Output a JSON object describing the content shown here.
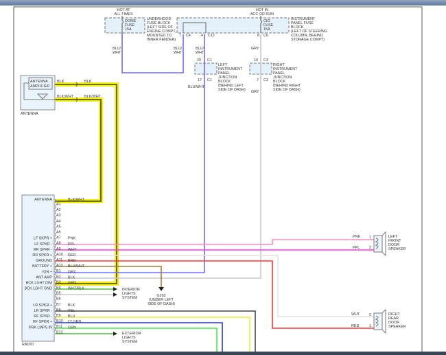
{
  "colors": {
    "blu_wht": "#6b6bff",
    "gry": "#c8c8c8",
    "blk": "#444444",
    "pnk": "#ff88bb",
    "ppl": "#ff33ee",
    "wht": "#e2e2e2",
    "red": "#ff3333",
    "brn": "#9a7a3a",
    "grn": "#55bb44",
    "yel": "#f0f030",
    "blu": "#2233ee",
    "lt_grn": "#44ee44",
    "highlight": "#f5f000",
    "fuse_block_fill": "#e4f1fb"
  },
  "power": {
    "hot_at_all_times": [
      "HOT AT",
      "ALL TIMES"
    ],
    "hot_in_acc_or_run": [
      "HOT IN",
      "ACC OR RUN"
    ]
  },
  "underhood_fuse_block": {
    "fuse": [
      "DOME",
      "FUSE",
      "15A"
    ],
    "label": [
      "UNDERHOOD",
      "FUSE BLOCK",
      "(LEFT SIDE OF",
      "ENGINE COMPT,",
      "MOUNTED TO",
      "INNER FENDER)"
    ]
  },
  "ip_fuse_block": {
    "fuse": [
      "CIG",
      "FUSE",
      "15A"
    ],
    "label": [
      "INSTRUMENT",
      "PANEL FUSE",
      "BLOCK",
      "(LEFT OF STEERING",
      "COLUMN, BEHIND",
      "STORAGE COMPT)"
    ]
  },
  "connectors": {
    "c4_pin": "7",
    "c4": "C4",
    "c12_pin": "4",
    "c12": "C12",
    "c6_pin": "8",
    "c6": "C6",
    "lc1_in_pin": "20",
    "lc1_in": "C1",
    "lc1_out_pin": "17",
    "lc1_out": "C1",
    "rc3_in_pin": "10",
    "rc3_in": "C3",
    "rc3_out_pin": "7",
    "rc3_out": "C3"
  },
  "left_junction_block": [
    "LEFT",
    "INSTRUMENT",
    "PANEL",
    "JUNCTION",
    "BLOCK",
    "(BEHIND LEFT",
    "SIDE OF DASH)"
  ],
  "right_junction_block": [
    "RIGHT",
    "INSTRUMENT",
    "PANEL",
    "JUNCTION",
    "BLOCK",
    "(BEHIND RIGHT",
    "SIDE OF DASH)"
  ],
  "wire_labels": {
    "dome_blu_wht": [
      "BLU/",
      "WHT"
    ],
    "c4_blu_wht": [
      "BLU/",
      "WHT"
    ],
    "c12_blu_wht": [
      "BLU/",
      "WHT"
    ],
    "c6_gry": "GRY",
    "c1_blu_wht": "BLU/WHT",
    "c3_gry": "GRY",
    "ant_blk_1": "BLK",
    "ant_blk_2": "BLK",
    "ant_blkwht_1": "BLK/WHT",
    "ant_blkwht_2": "BLK/WHT"
  },
  "antenna": {
    "amplifier": [
      "ANTENNA",
      "AMPLIFIER"
    ],
    "label": "ANTENNA"
  },
  "radio": {
    "label": "RADIO",
    "pins": [
      {
        "pin": "A1",
        "func": "ANTENNA",
        "wire": "BLK/WHT"
      },
      {
        "pin": "A2",
        "func": "",
        "wire": ""
      },
      {
        "pin": "A3",
        "func": "",
        "wire": ""
      },
      {
        "pin": "A4",
        "func": "",
        "wire": ""
      },
      {
        "pin": "A5",
        "func": "",
        "wire": ""
      },
      {
        "pin": "A6",
        "func": "",
        "wire": ""
      },
      {
        "pin": "A7",
        "func": "",
        "wire": ""
      },
      {
        "pin": "A8",
        "func": "LF SKPR +",
        "wire": "PNK"
      },
      {
        "pin": "A9",
        "func": "LF SPKR -",
        "wire": "PPL"
      },
      {
        "pin": "A10",
        "func": "RR SPKR -",
        "wire": "WHT"
      },
      {
        "pin": "A11",
        "func": "RR SPKR +",
        "wire": "RED"
      },
      {
        "pin": "A12",
        "func": "GROUND",
        "wire": "BRN"
      },
      {
        "pin": "B1",
        "func": "BATTERY +",
        "wire": "BLU/WHT"
      },
      {
        "pin": "B2",
        "func": "IGN +",
        "wire": "GRY"
      },
      {
        "pin": "B3",
        "func": "ANT AMP",
        "wire": "BLK"
      },
      {
        "pin": "B4",
        "func": "BCK LGHT DIM",
        "wire": "GRN"
      },
      {
        "pin": "B5",
        "func": "BCK LGHT GND",
        "wire": "WHT/BLK"
      },
      {
        "pin": "B6",
        "func": "",
        "wire": ""
      },
      {
        "pin": "B7",
        "func": "",
        "wire": ""
      },
      {
        "pin": "B8",
        "func": "LR SPKR +",
        "wire": "BLK"
      },
      {
        "pin": "B9",
        "func": "LR SPKR -",
        "wire": "YEL"
      },
      {
        "pin": "B10",
        "func": "RF SPKR -",
        "wire": "BLU"
      },
      {
        "pin": "B11",
        "func": "RF SPKR +",
        "wire": "LT GRN"
      },
      {
        "pin": "B12",
        "func": "PRK LMPS IN",
        "wire": "GRN"
      }
    ]
  },
  "interior_lights": [
    "INTERIOR",
    "LIGHTS",
    "SYSTEM"
  ],
  "exterior_lights": [
    "EXTERIOR",
    "LIGHTS",
    "SYSTEM"
  ],
  "ground": [
    "G202",
    "(UNDER LEFT",
    "SIDE OF DASH)"
  ],
  "left_front_speaker": {
    "label": [
      "LEFT",
      "FRONT",
      "DOOR",
      "SPEAKER"
    ],
    "pin1": "1",
    "pin2": "2",
    "wire1": "PNK",
    "wire2": "PPL"
  },
  "right_rear_speaker": {
    "label": [
      "RIGHT",
      "REAR",
      "DOOR",
      "SPEAKER"
    ],
    "pin1": "2",
    "pin2": "1",
    "wire1": "WHT",
    "wire2": "RED"
  }
}
